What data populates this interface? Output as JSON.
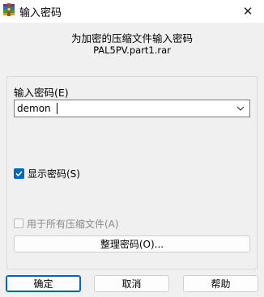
{
  "window": {
    "title": "输入密码",
    "close_symbol": "✕"
  },
  "header": {
    "prompt": "为加密的压缩文件输入密码",
    "filename": "PAL5PV.part1.rar"
  },
  "password": {
    "label": "输入密码(E)",
    "value": "demon"
  },
  "options": {
    "show_password_label": "显示密码(S)",
    "show_password_checked": true,
    "apply_all_label": "用于所有压缩文件(A)",
    "apply_all_checked": false,
    "organize_button": "整理密码(O)..."
  },
  "buttons": {
    "ok": "确定",
    "cancel": "取消",
    "help": "帮助"
  },
  "icons": {
    "app": "winrar-icon",
    "close": "close-icon",
    "dropdown": "chevron-down-icon",
    "check": "checkmark-icon"
  },
  "colors": {
    "accent": "#0067c0"
  }
}
